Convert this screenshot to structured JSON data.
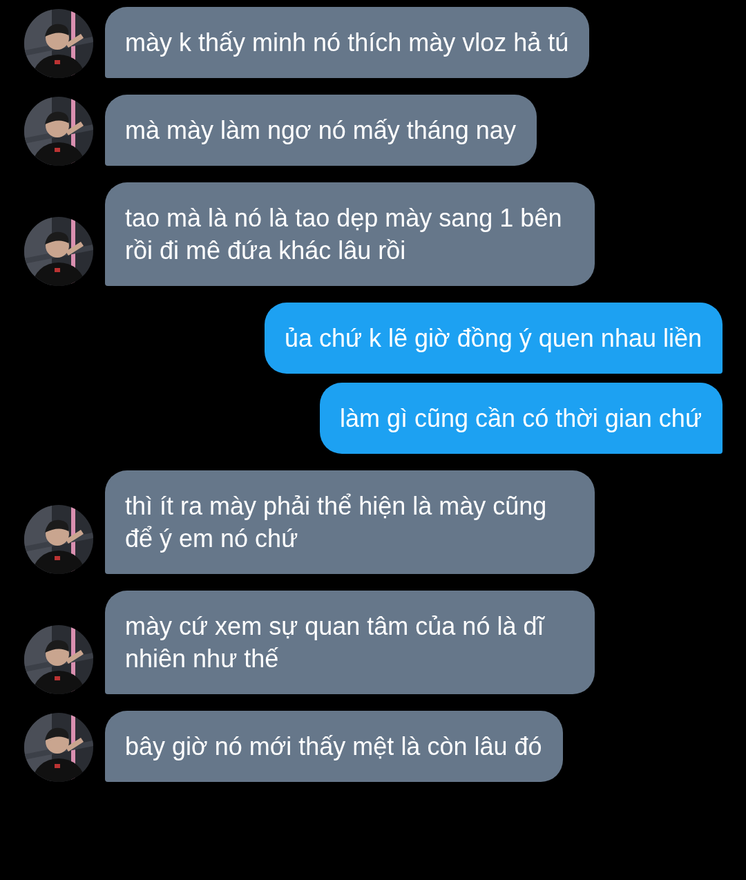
{
  "messages": [
    {
      "kind": "received",
      "text": "mày k thấy minh nó thích mày vloz hả tú"
    },
    {
      "kind": "received",
      "text": "mà mày làm ngơ nó mấy tháng nay"
    },
    {
      "kind": "received",
      "text": "tao mà là nó là tao dẹp mày sang 1 bên rồi đi mê đứa khác lâu rồi"
    },
    {
      "kind": "sent",
      "text": "ủa chứ k lẽ giờ đồng ý quen nhau liền"
    },
    {
      "kind": "sent",
      "text": "làm gì cũng cần có thời gian chứ"
    },
    {
      "kind": "received",
      "text": "thì ít ra mày phải thể hiện là mày cũng để ý em nó chứ"
    },
    {
      "kind": "received",
      "text": "mày cứ xem sự quan tâm của nó là dĩ nhiên như thế"
    },
    {
      "kind": "received",
      "text": "bây giờ nó mới thấy mệt là còn lâu đó"
    }
  ]
}
